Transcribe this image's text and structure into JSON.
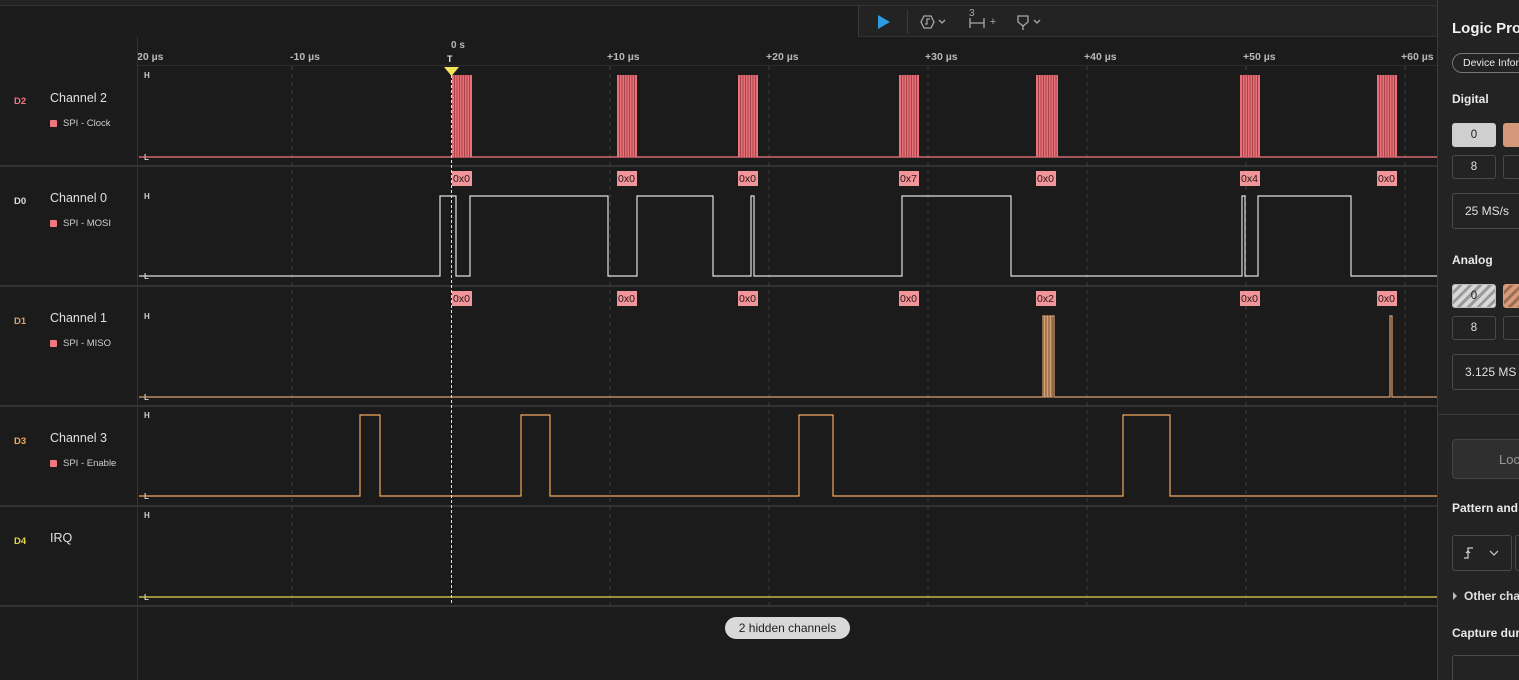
{
  "toolbar": {
    "play_icon": "play-icon",
    "trigger_icon": "trigger-icon",
    "measure_badge": "3",
    "measure_plus": "+",
    "marker_icon": "marker-icon"
  },
  "timeline": {
    "zero_label": "0 s",
    "trigger_marker": "T",
    "ticks": [
      "20 µs",
      "-10 µs",
      "+10 µs",
      "+20 µs",
      "+30 µs",
      "+40 µs",
      "+50 µs",
      "+60 µs"
    ]
  },
  "channels": [
    {
      "code": "D2",
      "name": "Channel 2",
      "analyzer": "SPI - Clock",
      "color": "#f2767e"
    },
    {
      "code": "D0",
      "name": "Channel 0",
      "analyzer": "SPI - MOSI",
      "color": "#e0e0e0"
    },
    {
      "code": "D1",
      "name": "Channel 1",
      "analyzer": "SPI - MISO",
      "color": "#d9a070"
    },
    {
      "code": "D3",
      "name": "Channel 3",
      "analyzer": "SPI - Enable",
      "color": "#f2a860"
    },
    {
      "code": "D4",
      "name": "IRQ",
      "analyzer": "",
      "color": "#e6d54a"
    }
  ],
  "levels": {
    "high": "H",
    "low": "L"
  },
  "decoded": {
    "mosi": [
      "0x0",
      "0x0",
      "0x0",
      "0x7",
      "0x0",
      "0x4",
      "0x0"
    ],
    "miso": [
      "0x0",
      "0x0",
      "0x0",
      "0x0",
      "0x2",
      "0x0",
      "0x0"
    ]
  },
  "hidden_channels": "2 hidden channels",
  "panel": {
    "title": "Logic Pro",
    "device_chip": "Device Infor",
    "digital_heading": "Digital",
    "digital_first": "0",
    "digital_second": "8",
    "digital_rate": "25 MS/s",
    "analog_heading": "Analog",
    "analog_first": "0",
    "analog_second": "8",
    "analog_rate": "3.125 MS",
    "lock_button": "Loc",
    "pattern_heading": "Pattern and",
    "other_channels": "Other cha",
    "capture_heading": "Capture dur"
  }
}
